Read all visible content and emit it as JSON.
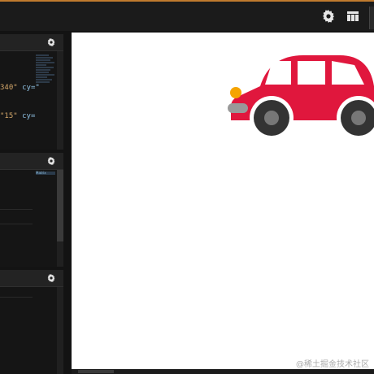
{
  "toolbar": {
    "settings_icon": "gear-icon",
    "layout_icon": "layout-grid-icon"
  },
  "editors": [
    {
      "panel": "html",
      "settings_icon": "gear-icon",
      "code_line_1": {
        "value": "340\"",
        "attr": " cy=\""
      },
      "code_line_2": {
        "value": "\"15\"",
        "attr": " cy="
      }
    },
    {
      "panel": "css",
      "settings_icon": "gear-icon",
      "minimap_label": "Matrix"
    },
    {
      "panel": "js",
      "settings_icon": "gear-icon"
    }
  ],
  "preview": {
    "car": {
      "body_color": "#e0173d",
      "window_color": "#ffffff",
      "tire_color": "#333333",
      "hubcap_color": "#777777",
      "headlight_color": "#f5a400",
      "bumper_color": "#999999"
    }
  },
  "watermark": "@稀土掘金技术社区"
}
